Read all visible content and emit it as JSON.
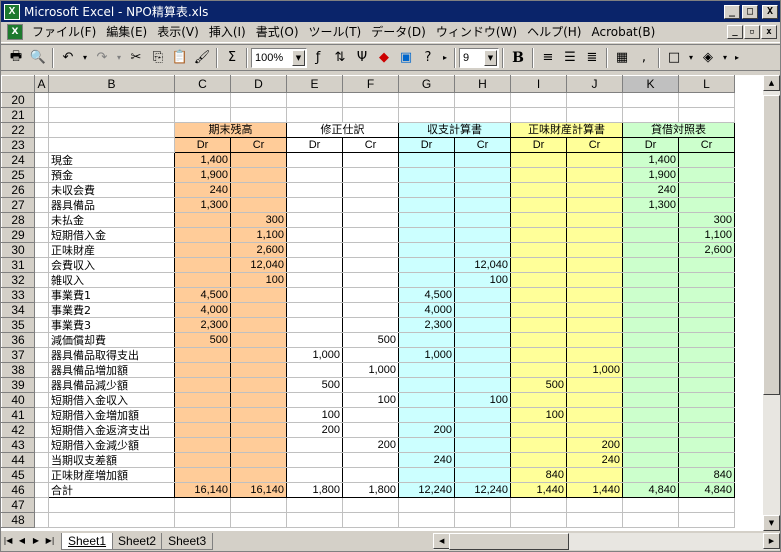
{
  "window": {
    "title": "Microsoft Excel - NPO精算表.xls",
    "app_icon": "X",
    "buttons": {
      "minimize": "_",
      "maximize": "□",
      "close": "X"
    }
  },
  "menu": {
    "items": [
      "ファイル(F)",
      "編集(E)",
      "表示(V)",
      "挿入(I)",
      "書式(O)",
      "ツール(T)",
      "データ(D)",
      "ウィンドウ(W)",
      "ヘルプ(H)",
      "Acrobat(B)"
    ],
    "mdi_buttons": {
      "minimize": "_",
      "restore": "▫",
      "close": "x"
    }
  },
  "toolbar": {
    "zoom_value": "100%",
    "font_size_value": "9",
    "bold_label": "B",
    "sigma_label": "Σ",
    "icons": [
      "print-icon",
      "preview-icon",
      "undo-icon",
      "redo-icon",
      "cut-icon",
      "copy-icon",
      "paste-icon",
      "format-painter-icon",
      "sum-icon",
      "acrobat-icon",
      "help-icon"
    ]
  },
  "sheet": {
    "columns": [
      "A",
      "B",
      "C",
      "D",
      "E",
      "F",
      "G",
      "H",
      "I",
      "J",
      "K",
      "L"
    ],
    "active_column": "K",
    "groups": [
      {
        "label": "期末残高",
        "color": "#ffcc99"
      },
      {
        "label": "修正仕訳",
        "color": "#ffffff"
      },
      {
        "label": "収支計算書",
        "color": "#ccffff"
      },
      {
        "label": "正味財産計算書",
        "color": "#ffff99"
      },
      {
        "label": "貸借対照表",
        "color": "#ccffcc"
      }
    ],
    "dr_label": "Dr",
    "cr_label": "Cr",
    "rows": [
      {
        "n": "20"
      },
      {
        "n": "21"
      },
      {
        "n": "22",
        "type": "group"
      },
      {
        "n": "23",
        "type": "drcr"
      },
      {
        "n": "24",
        "label": "現金",
        "v": [
          "1,400",
          "",
          "",
          "",
          "",
          "",
          "",
          "",
          "1,400",
          ""
        ]
      },
      {
        "n": "25",
        "label": "預金",
        "v": [
          "1,900",
          "",
          "",
          "",
          "",
          "",
          "",
          "",
          "1,900",
          ""
        ]
      },
      {
        "n": "26",
        "label": "未収会費",
        "v": [
          "240",
          "",
          "",
          "",
          "",
          "",
          "",
          "",
          "240",
          ""
        ]
      },
      {
        "n": "27",
        "label": "器具備品",
        "v": [
          "1,300",
          "",
          "",
          "",
          "",
          "",
          "",
          "",
          "1,300",
          ""
        ]
      },
      {
        "n": "28",
        "label": "未払金",
        "v": [
          "",
          "300",
          "",
          "",
          "",
          "",
          "",
          "",
          "",
          "300"
        ]
      },
      {
        "n": "29",
        "label": "短期借入金",
        "v": [
          "",
          "1,100",
          "",
          "",
          "",
          "",
          "",
          "",
          "",
          "1,100"
        ]
      },
      {
        "n": "30",
        "label": "正味財産",
        "v": [
          "",
          "2,600",
          "",
          "",
          "",
          "",
          "",
          "",
          "",
          "2,600"
        ]
      },
      {
        "n": "31",
        "label": "会費収入",
        "v": [
          "",
          "12,040",
          "",
          "",
          "",
          "12,040",
          "",
          "",
          "",
          ""
        ]
      },
      {
        "n": "32",
        "label": "雑収入",
        "v": [
          "",
          "100",
          "",
          "",
          "",
          "100",
          "",
          "",
          "",
          ""
        ]
      },
      {
        "n": "33",
        "label": "事業費1",
        "v": [
          "4,500",
          "",
          "",
          "",
          "4,500",
          "",
          "",
          "",
          "",
          ""
        ]
      },
      {
        "n": "34",
        "label": "事業費2",
        "v": [
          "4,000",
          "",
          "",
          "",
          "4,000",
          "",
          "",
          "",
          "",
          ""
        ]
      },
      {
        "n": "35",
        "label": "事業費3",
        "v": [
          "2,300",
          "",
          "",
          "",
          "2,300",
          "",
          "",
          "",
          "",
          ""
        ]
      },
      {
        "n": "36",
        "label": "減価償却費",
        "v": [
          "500",
          "",
          "",
          "500",
          "",
          "",
          "",
          "",
          "",
          ""
        ]
      },
      {
        "n": "37",
        "label": "器具備品取得支出",
        "v": [
          "",
          "",
          "1,000",
          "",
          "1,000",
          "",
          "",
          "",
          "",
          ""
        ]
      },
      {
        "n": "38",
        "label": "器具備品増加額",
        "v": [
          "",
          "",
          "",
          "1,000",
          "",
          "",
          "",
          "1,000",
          "",
          ""
        ]
      },
      {
        "n": "39",
        "label": "器具備品減少額",
        "v": [
          "",
          "",
          "500",
          "",
          "",
          "",
          "500",
          "",
          "",
          ""
        ]
      },
      {
        "n": "40",
        "label": "短期借入金収入",
        "v": [
          "",
          "",
          "",
          "100",
          "",
          "100",
          "",
          "",
          "",
          ""
        ]
      },
      {
        "n": "41",
        "label": "短期借入金増加額",
        "v": [
          "",
          "",
          "100",
          "",
          "",
          "",
          "100",
          "",
          "",
          ""
        ]
      },
      {
        "n": "42",
        "label": "短期借入金返済支出",
        "v": [
          "",
          "",
          "200",
          "",
          "200",
          "",
          "",
          "",
          "",
          ""
        ]
      },
      {
        "n": "43",
        "label": "短期借入金減少額",
        "v": [
          "",
          "",
          "",
          "200",
          "",
          "",
          "",
          "200",
          "",
          ""
        ]
      },
      {
        "n": "44",
        "label": "当期収支差額",
        "v": [
          "",
          "",
          "",
          "",
          "240",
          "",
          "",
          "240",
          "",
          ""
        ]
      },
      {
        "n": "45",
        "label": "正味財産増加額",
        "v": [
          "",
          "",
          "",
          "",
          "",
          "",
          "840",
          "",
          "",
          "840"
        ]
      },
      {
        "n": "46",
        "label": "合計",
        "v": [
          "16,140",
          "16,140",
          "1,800",
          "1,800",
          "12,240",
          "12,240",
          "1,440",
          "1,440",
          "4,840",
          "4,840"
        ],
        "total": true
      },
      {
        "n": "47"
      },
      {
        "n": "48"
      }
    ]
  },
  "tabs": {
    "nav": [
      "|◀",
      "◀",
      "▶",
      "▶|"
    ],
    "sheets": [
      "Sheet1",
      "Sheet2",
      "Sheet3"
    ],
    "active": "Sheet1"
  }
}
